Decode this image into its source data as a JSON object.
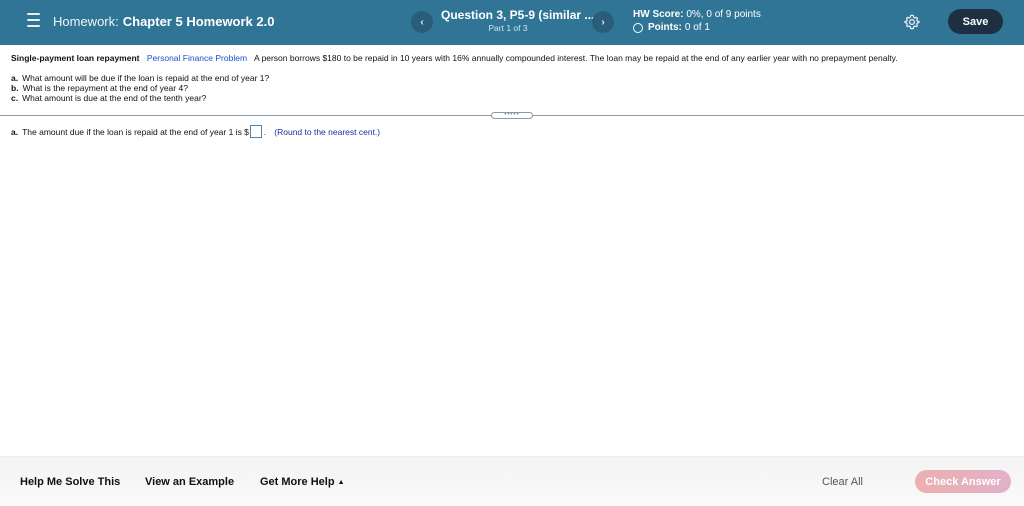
{
  "header": {
    "menu_icon": "hamburger-menu-icon",
    "homework_prefix": "Homework:",
    "homework_title": "Chapter 5 Homework 2.0",
    "question_title": "Question 3, P5-9 (similar ...",
    "question_part": "Part 1 of 3",
    "prev_icon": "‹",
    "next_icon": "›",
    "hw_score_label": "HW Score:",
    "hw_score_value": "0%, 0 of 9 points",
    "points_label": "Points:",
    "points_value": "0 of 1",
    "settings_icon": "gear-icon",
    "save_label": "Save"
  },
  "problem": {
    "title": "Single-payment loan repayment",
    "link": "Personal Finance Problem",
    "statement": "A person borrows $180 to be repaid in 10 years with 16% annually compounded interest.  The loan may be repaid at the end of any earlier year with no prepayment penalty.",
    "questions": [
      {
        "letter": "a.",
        "text": "What amount will be due if the loan is repaid at the end of year 1?"
      },
      {
        "letter": "b.",
        "text": "What is the repayment at the end of year 4?"
      },
      {
        "letter": "c.",
        "text": "What amount is due at the end of the tenth year?"
      }
    ]
  },
  "divider": {
    "handle_dots": "•••••"
  },
  "answer": {
    "letter": "a.",
    "prompt": "The amount due if the loan is repaid at the end of year 1 is $",
    "value": "",
    "suffix": ".",
    "hint": "(Round to the nearest cent.)"
  },
  "footer": {
    "help_solve": "Help Me Solve This",
    "view_example": "View an Example",
    "more_help": "Get More Help",
    "more_help_caret": "▲",
    "clear_all": "Clear All",
    "check_answer": "Check Answer"
  },
  "colors": {
    "header_bg": "#317596",
    "save_bg": "#1d2f40",
    "link": "#1a4fd1",
    "check_answer_bg": "#ebb0b0"
  }
}
